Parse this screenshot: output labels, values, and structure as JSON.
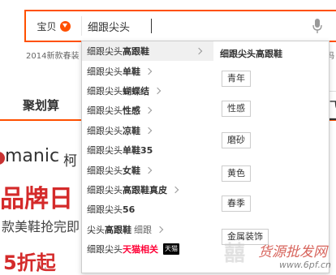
{
  "search": {
    "scope_label": "宝贝",
    "query": "细跟尖头"
  },
  "background": {
    "hot_prefix": "2014新款春装",
    "hot_suffix": "吗",
    "nav_left": "聚划算",
    "nav_right": "飞",
    "brand": "manic",
    "brand_tail": "柯",
    "headline": "品牌日",
    "subline": "款美鞋抢完即",
    "discount": "5折起",
    "discount_tail": "…"
  },
  "suggestions": [
    {
      "base": "细跟尖头",
      "hl": "高跟鞋",
      "chevron": true,
      "chevron_far": true,
      "active": true
    },
    {
      "base": "细跟尖头",
      "hl": "单鞋",
      "chevron": true
    },
    {
      "base": "细跟尖头",
      "hl": "蝴蝶结",
      "chevron": true
    },
    {
      "base": "细跟尖头",
      "hl": "性感",
      "chevron": true
    },
    {
      "base": "细跟尖头",
      "hl": "凉鞋",
      "chevron": true
    },
    {
      "base": "细跟尖头",
      "hl": "单鞋35",
      "chevron": false
    },
    {
      "base": "细跟尖头",
      "hl": "女鞋",
      "chevron": true
    },
    {
      "base": "细跟尖头",
      "hl": "高跟鞋真皮",
      "chevron": true
    },
    {
      "base": "细跟尖头",
      "hl": "56",
      "chevron": false
    },
    {
      "base": "尖头",
      "hl": "高跟鞋",
      "tag": "细跟",
      "chevron": true
    },
    {
      "base": "细跟尖头",
      "hl": "天猫相关",
      "hl_red": true,
      "badge": "天猫",
      "chevron": false
    }
  ],
  "attr_panel": {
    "title": "细跟尖头高跟鞋",
    "tags": [
      "青年",
      "性感",
      "磨砂",
      "黄色",
      "春季",
      "金属装饰"
    ]
  },
  "watermark": {
    "seal": "囍",
    "cn": "货源批发网",
    "url": "www.6pf.cn"
  },
  "colors": {
    "accent": "#ff5000",
    "tmall_red": "#ff0036"
  },
  "icons": {
    "scope_arrow": "chevron-down-icon",
    "mic": "microphone-icon",
    "chevron": "chevron-right-icon"
  }
}
